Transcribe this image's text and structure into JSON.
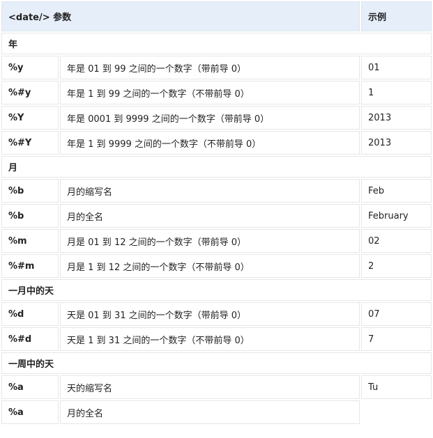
{
  "header": {
    "param": "<date/> 参数",
    "example": "示例"
  },
  "sections": [
    {
      "title": "年",
      "rows": [
        {
          "key": "%y",
          "desc": "年是 01 到 99 之间的一个数字（带前导 0）",
          "example": "01"
        },
        {
          "key": "%#y",
          "desc": "年是 1 到 99 之间的一个数字（不带前导 0）",
          "example": "1"
        },
        {
          "key": "%Y",
          "desc": "年是 0001 到 9999 之间的一个数字（带前导 0）",
          "example": "2013"
        },
        {
          "key": "%#Y",
          "desc": "年是 1 到 9999 之间的一个数字（不带前导 0）",
          "example": "2013"
        }
      ]
    },
    {
      "title": "月",
      "rows": [
        {
          "key": "%b",
          "desc": "月的缩写名",
          "example": "Feb"
        },
        {
          "key": "%b",
          "desc": "月的全名",
          "example": "February"
        },
        {
          "key": "%m",
          "desc": "月是 01 到 12 之间的一个数字（带前导 0）",
          "example": "02"
        },
        {
          "key": "%#m",
          "desc": "月是 1 到 12 之间的一个数字（不带前导 0）",
          "example": "2"
        }
      ]
    },
    {
      "title": "一月中的天",
      "rows": [
        {
          "key": "%d",
          "desc": "天是 01 到 31 之间的一个数字（带前导 0）",
          "example": "07"
        },
        {
          "key": "%#d",
          "desc": "天是 1 到 31 之间的一个数字（不带前导 0）",
          "example": "7"
        }
      ]
    },
    {
      "title": "一周中的天",
      "rows": [
        {
          "key": "%a",
          "desc": "天的缩写名",
          "example": "Tu"
        },
        {
          "key": "%a",
          "desc": "月的全名",
          "example": ""
        }
      ]
    }
  ]
}
